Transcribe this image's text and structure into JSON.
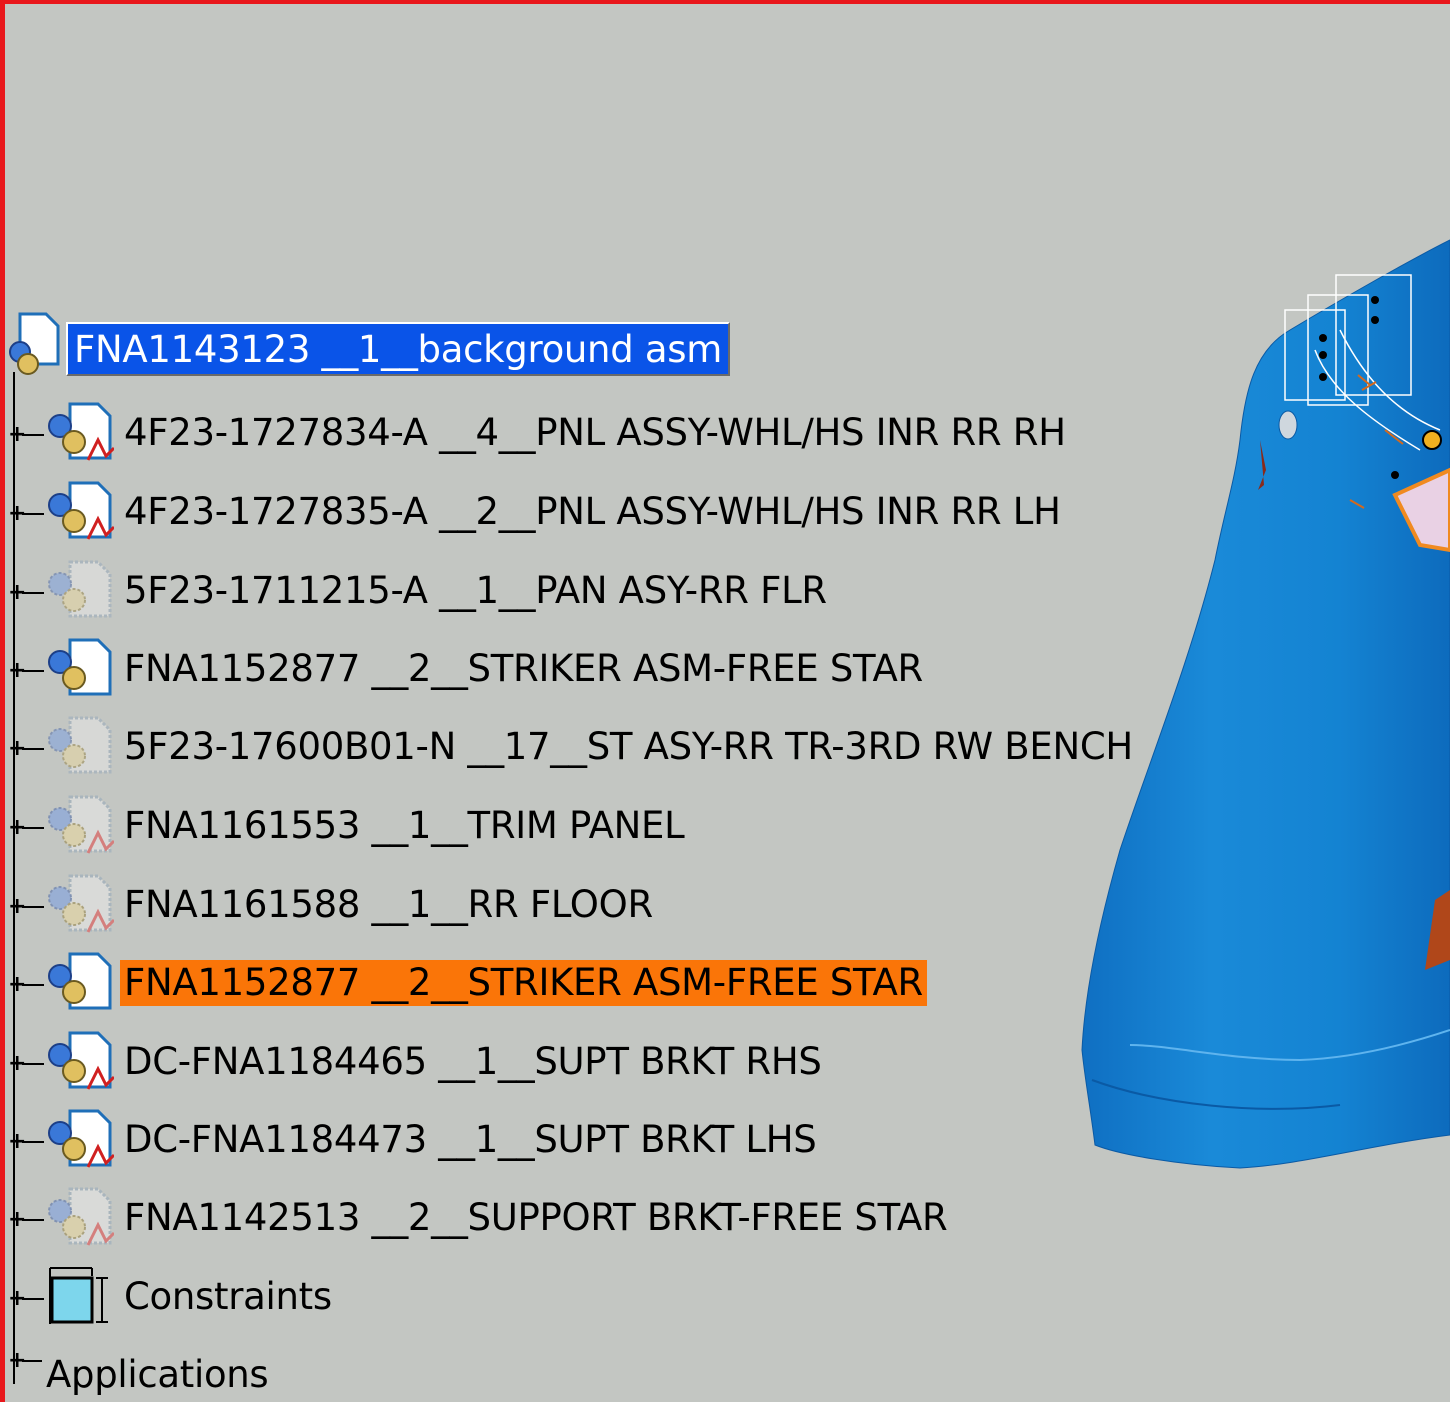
{
  "colors": {
    "background": "#c3c6c2",
    "frame_border": "#e8171b",
    "selection_blue": "#0a54e8",
    "highlight_orange": "#fa7508",
    "model_blue": "#1a8ad8"
  },
  "tree": {
    "root": {
      "label": "FNA1143123 __1__background asm",
      "icon": "product-root-icon",
      "state": "selected"
    },
    "children": [
      {
        "label": "4F23-1727834-A __4__PNL ASSY-WHL/HS INR RR RH",
        "icon": "product-with-part-icon",
        "state": "normal"
      },
      {
        "label": "4F23-1727835-A __2__PNL ASSY-WHL/HS INR RR LH",
        "icon": "product-with-part-icon",
        "state": "normal"
      },
      {
        "label": "5F23-1711215-A __1__PAN ASY-RR FLR",
        "icon": "product-hidden-icon",
        "state": "normal"
      },
      {
        "label": "FNA1152877 __2__STRIKER ASM-FREE STAR",
        "icon": "product-icon",
        "state": "normal"
      },
      {
        "label": "5F23-17600B01-N __17__ST ASY-RR TR-3RD RW BENCH",
        "icon": "product-hidden-icon",
        "state": "normal"
      },
      {
        "label": "FNA1161553 __1__TRIM PANEL",
        "icon": "product-part-hidden-icon",
        "state": "normal"
      },
      {
        "label": "FNA1161588 __1__RR FLOOR",
        "icon": "product-part-hidden-icon",
        "state": "normal"
      },
      {
        "label": "FNA1152877 __2__STRIKER ASM-FREE STAR",
        "icon": "product-icon",
        "state": "highlighted"
      },
      {
        "label": "DC-FNA1184465 __1__SUPT BRKT RHS",
        "icon": "product-with-part-icon",
        "state": "normal"
      },
      {
        "label": "DC-FNA1184473 __1__SUPT BRKT LHS",
        "icon": "product-with-part-icon",
        "state": "normal"
      },
      {
        "label": "FNA1142513 __2__SUPPORT BRKT-FREE STAR",
        "icon": "product-part-hidden-icon",
        "state": "normal"
      },
      {
        "label": "Constraints",
        "icon": "constraints-icon",
        "state": "normal"
      }
    ],
    "applications": {
      "label": "Applications"
    }
  }
}
